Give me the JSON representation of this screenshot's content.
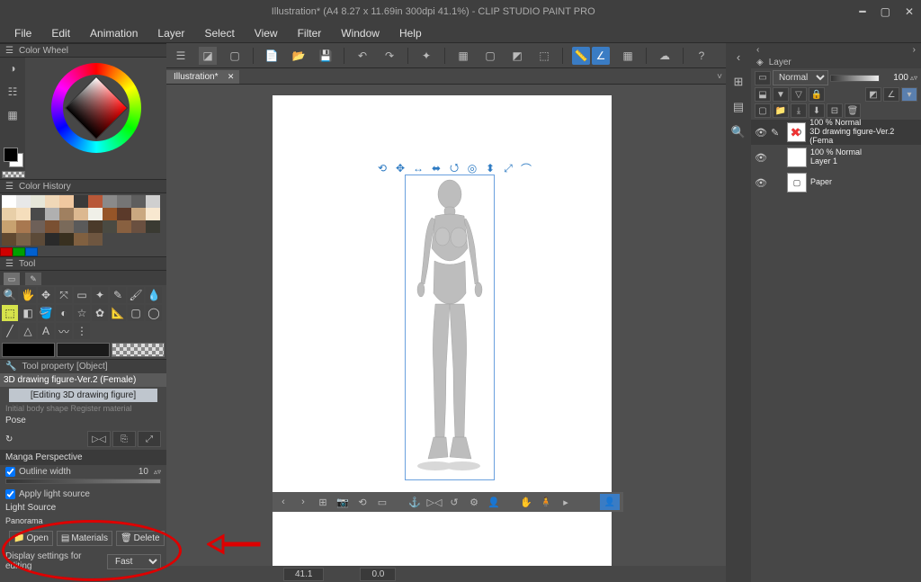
{
  "app": {
    "title": "Illustration* (A4 8.27 x 11.69in 300dpi 41.1%)  -  CLIP STUDIO PAINT PRO"
  },
  "menu": [
    "File",
    "Edit",
    "Animation",
    "Layer",
    "Select",
    "View",
    "Filter",
    "Window",
    "Help"
  ],
  "doc_tab": {
    "label": "Illustration*"
  },
  "panels": {
    "color_wheel": "Color Wheel",
    "color_history": "Color History",
    "tool": "Tool",
    "tool_property": "Tool property [Object]",
    "layer": "Layer"
  },
  "swatch_colors": [
    "#ffffff",
    "#e8e8e8",
    "#e6e6d8",
    "#f0d8b8",
    "#f0c8a0",
    "#3a3a3a",
    "#b85838",
    "#8a8a8a",
    "#757575",
    "#5e5e5e",
    "#cfcfcf",
    "#e8cfa8",
    "#f5debc",
    "#4a4a4a",
    "#b0b0b0",
    "#a08060",
    "#dcb890",
    "#f0f0e8",
    "#965528",
    "#5b3a2a",
    "#caa880",
    "#f8e8d0",
    "#c8a270",
    "#a87850",
    "#6e6058",
    "#7a5032",
    "#7a6a5a",
    "#5a5a5a",
    "#4a3a2a",
    "#4a4a42",
    "#886040",
    "#6a5040",
    "#3a3a32",
    "#604830",
    "#7a6248",
    "#5c4a38",
    "#2a2a2a",
    "#383020",
    "#806040",
    "#6e5640"
  ],
  "accent_colors": [
    "#d00000",
    "#00a000",
    "#0060d0"
  ],
  "tool_property": {
    "object_name": "3D drawing figure-Ver.2 (Female)",
    "sub_label": "[Editing 3D drawing figure]",
    "behind_text": "Initial body shape    Register material",
    "pose_label": "Pose",
    "manga_perspective": "Manga Perspective",
    "outline_width": "Outline width",
    "outline_value": "10",
    "apply_light_source": "Apply light source",
    "light_source": "Light Source",
    "panorama": "Panorama",
    "btn_open": "Open",
    "btn_materials": "Materials",
    "btn_delete": "Delete",
    "display_settings": "Display settings for editing",
    "display_value": "Fast"
  },
  "canvas": {
    "zoom": "41.1",
    "rotation": "0.0"
  },
  "layer_panel": {
    "blend_mode": "Normal",
    "opacity": "100",
    "layers": [
      {
        "opacity": "100 %",
        "blend": "Normal",
        "name": "3D drawing figure-Ver.2 (Fema",
        "selected": true,
        "is3d": true
      },
      {
        "opacity": "100 %",
        "blend": "Normal",
        "name": "Layer 1",
        "selected": false,
        "is3d": false
      },
      {
        "name": "Paper",
        "is_paper": true
      }
    ]
  }
}
